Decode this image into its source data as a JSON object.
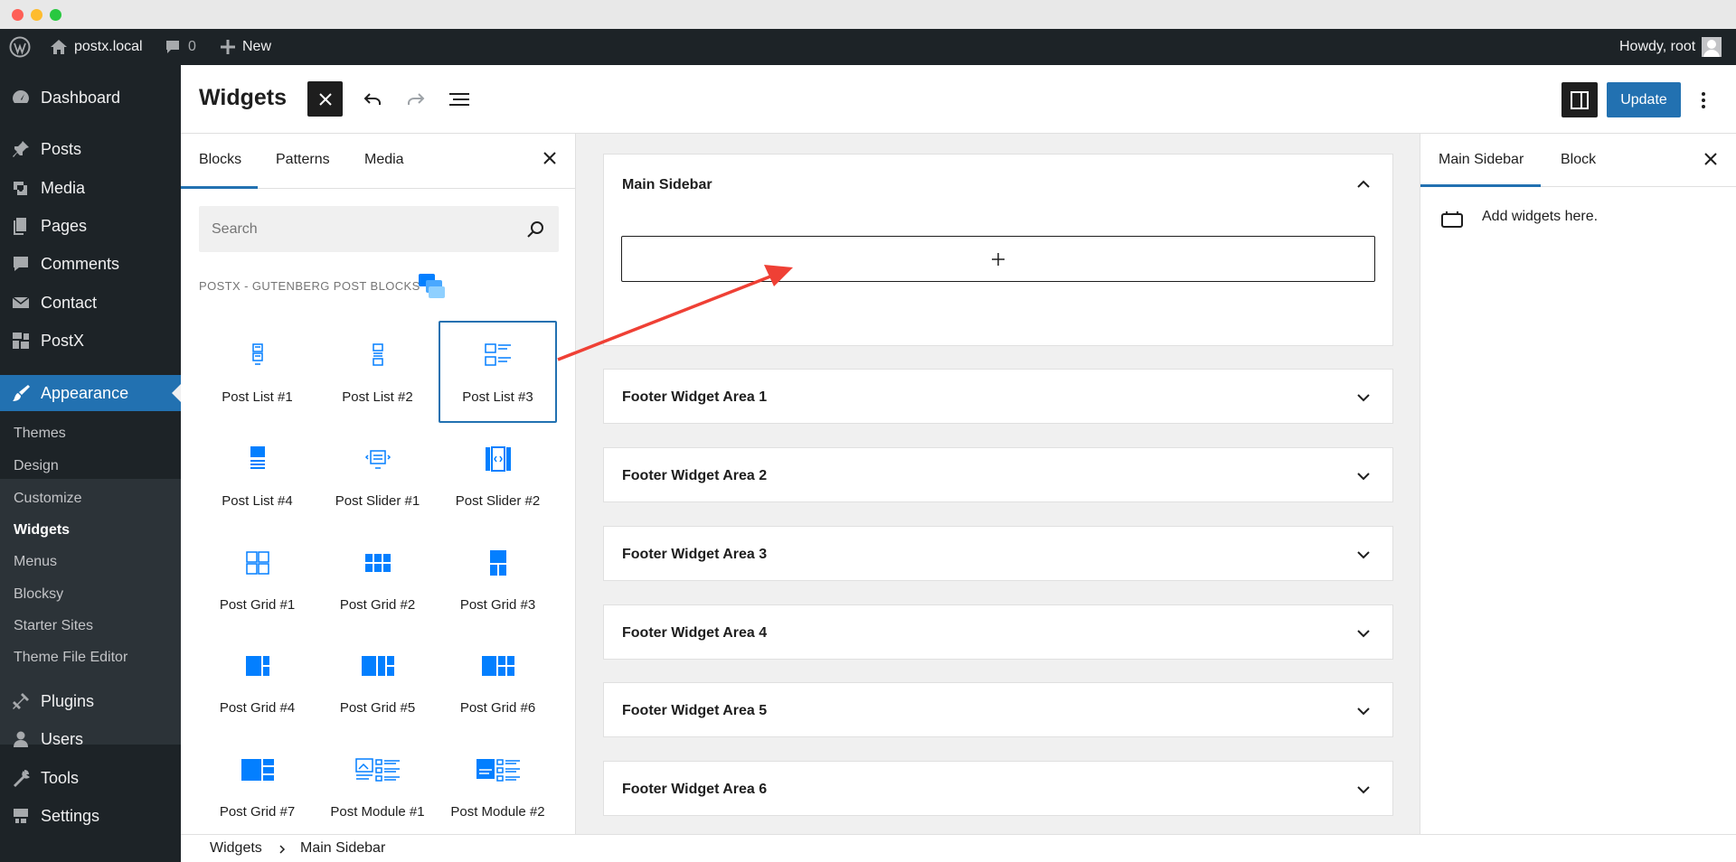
{
  "adminbar": {
    "site_name": "postx.local",
    "comments_count": "0",
    "new_label": "New",
    "greeting": "Howdy, root"
  },
  "menu": {
    "items": [
      {
        "label": "Dashboard",
        "icon": "dashboard-icon"
      },
      {
        "label": "Posts",
        "icon": "pin-icon"
      },
      {
        "label": "Media",
        "icon": "media-icon"
      },
      {
        "label": "Pages",
        "icon": "pages-icon"
      },
      {
        "label": "Comments",
        "icon": "comment-icon"
      },
      {
        "label": "Contact",
        "icon": "mail-icon"
      },
      {
        "label": "PostX",
        "icon": "postx-icon"
      },
      {
        "label": "Appearance",
        "icon": "brush-icon"
      },
      {
        "label": "Plugins",
        "icon": "plugin-icon"
      },
      {
        "label": "Users",
        "icon": "user-icon"
      },
      {
        "label": "Tools",
        "icon": "wrench-icon"
      },
      {
        "label": "Settings",
        "icon": "settings-icon"
      }
    ],
    "appearance_sub": [
      "Themes",
      "Design",
      "Customize",
      "Widgets",
      "Menus",
      "Blocksy",
      "Starter Sites",
      "Theme File Editor"
    ]
  },
  "header": {
    "title": "Widgets",
    "update_label": "Update"
  },
  "inserter": {
    "tabs": [
      "Blocks",
      "Patterns",
      "Media"
    ],
    "search_placeholder": "Search",
    "category": "PostX - Gutenberg Post Blocks",
    "blocks": [
      "Post List #1",
      "Post List #2",
      "Post List #3",
      "Post List #4",
      "Post Slider #1",
      "Post Slider #2",
      "Post Grid #1",
      "Post Grid #2",
      "Post Grid #3",
      "Post Grid #4",
      "Post Grid #5",
      "Post Grid #6",
      "Post Grid #7",
      "Post Module #1",
      "Post Module #2"
    ],
    "selected_block": "Post List #3"
  },
  "canvas": {
    "areas": [
      "Main Sidebar",
      "Footer Widget Area 1",
      "Footer Widget Area 2",
      "Footer Widget Area 3",
      "Footer Widget Area 4",
      "Footer Widget Area 5",
      "Footer Widget Area 6"
    ]
  },
  "settings": {
    "tabs": [
      "Main Sidebar",
      "Block"
    ],
    "empty_message": "Add widgets here."
  },
  "breadcrumb": [
    "Widgets",
    "Main Sidebar"
  ],
  "colors": {
    "admin_dark": "#1d2327",
    "wp_blue": "#2271b1",
    "postx_blue": "#037fff",
    "annotation_red": "#ef4035"
  }
}
